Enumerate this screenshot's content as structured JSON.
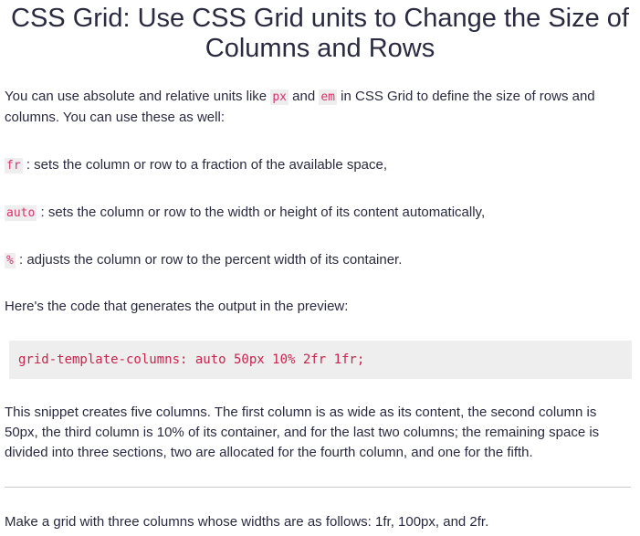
{
  "title_line1": "CSS Grid: Use CSS Grid units to Change the Size of",
  "title_line2": "Columns and Rows",
  "intro": {
    "part1": "You can use absolute and relative units like ",
    "code1": "px",
    "part2": " and ",
    "code2": "em",
    "part3": " in CSS Grid to define the size of rows and columns. You can use these as well:"
  },
  "units": [
    {
      "code": "fr",
      "text": ": sets the column or row to a fraction of the available space,"
    },
    {
      "code": "auto",
      "text": ": sets the column or row to the width or height of its content automatically,"
    },
    {
      "code": "%",
      "text": ": adjusts the column or row to the percent width of its container."
    }
  ],
  "preview_text": "Here's the code that generates the output in the preview:",
  "code_snippet": "grid-template-columns: auto 50px 10% 2fr 1fr;",
  "explanation": "This snippet creates five columns. The first column is as wide as its content, the second column is 50px, the third column is 10% of its container, and for the last two columns; the remaining space is divided into three sections, two are allocated for the fourth column, and one for the fifth.",
  "task": "Make a grid with three columns whose widths are as follows: 1fr, 100px, and 2fr."
}
